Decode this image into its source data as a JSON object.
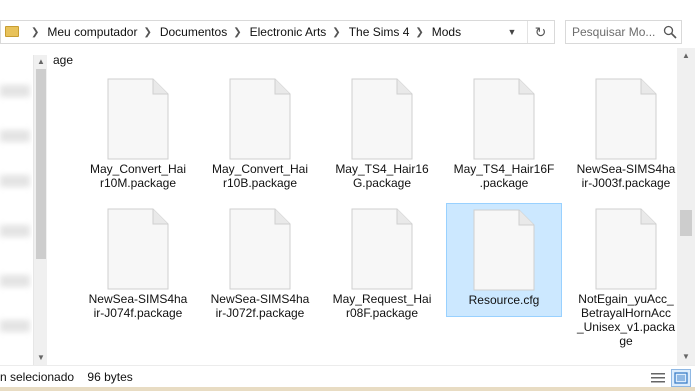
{
  "addressbar": {
    "breadcrumbs": [
      "Meu computador",
      "Documentos",
      "Electronic Arts",
      "The Sims 4",
      "Mods"
    ]
  },
  "search": {
    "placeholder": "Pesquisar Mo..."
  },
  "partial_top_label": "age",
  "files": [
    {
      "name": "May_Convert_Hair10M.package",
      "lines": [
        "May_Convert_Hai",
        "r10M.package"
      ],
      "selected": false
    },
    {
      "name": "May_Convert_Hair10B.package",
      "lines": [
        "May_Convert_Hai",
        "r10B.package"
      ],
      "selected": false
    },
    {
      "name": "May_TS4_Hair16G.package",
      "lines": [
        "May_TS4_Hair16",
        "G.package"
      ],
      "selected": false
    },
    {
      "name": "May_TS4_Hair16F.package",
      "lines": [
        "May_TS4_Hair16F",
        ".package"
      ],
      "selected": false
    },
    {
      "name": "NewSea-SIMS4hair-J003f.package",
      "lines": [
        "NewSea-SIMS4ha",
        "ir-J003f.package"
      ],
      "selected": false
    },
    {
      "name": "NewSea-SIMS4hair-J074f.package",
      "lines": [
        "NewSea-SIMS4ha",
        "ir-J074f.package"
      ],
      "selected": false
    },
    {
      "name": "NewSea-SIMS4hair-J072f.package",
      "lines": [
        "NewSea-SIMS4ha",
        "ir-J072f.package"
      ],
      "selected": false
    },
    {
      "name": "May_Request_Hair08F.package",
      "lines": [
        "May_Request_Hai",
        "r08F.package"
      ],
      "selected": false
    },
    {
      "name": "Resource.cfg",
      "lines": [
        "Resource.cfg"
      ],
      "selected": true
    },
    {
      "name": "NotEgain_yuAcc_BetrayalHornAcc_Unisex_v1.package",
      "lines": [
        "NotEgain_yuAcc_",
        "BetrayalHornAcc",
        "_Unisex_v1.packa",
        "ge"
      ],
      "selected": false
    }
  ],
  "statusbar": {
    "selected_text": "n selecionado",
    "size_text": "96 bytes"
  },
  "icons": {
    "folder": "folder-icon",
    "refresh": "refresh-icon",
    "search": "search-icon",
    "file": "generic-file-icon",
    "details_view": "details-view-icon",
    "large_icons_view": "large-icons-view-icon"
  },
  "colors": {
    "selection_fill": "#cce8ff",
    "selection_border": "#99d1ff"
  }
}
